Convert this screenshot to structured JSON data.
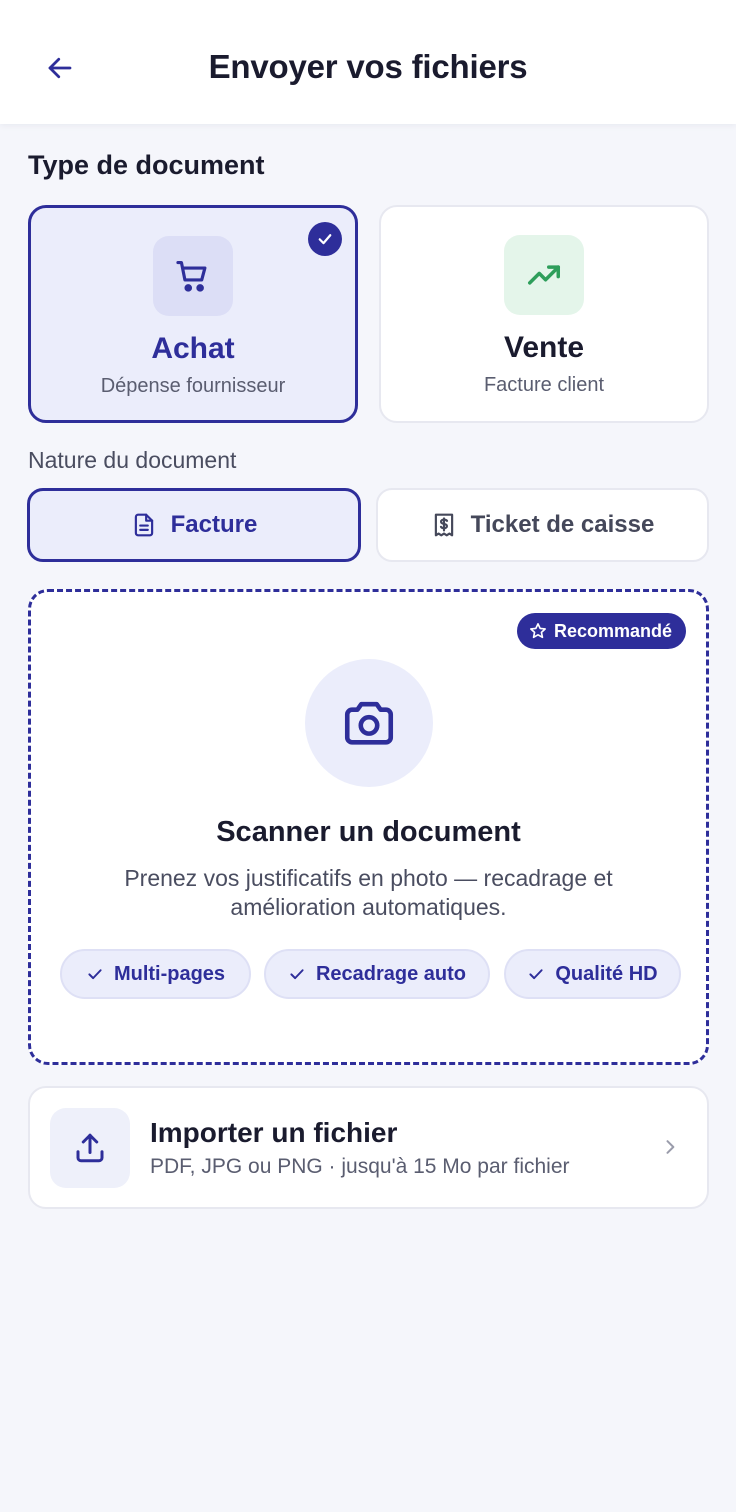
{
  "header": {
    "title": "Envoyer vos fichiers",
    "back_icon": "arrow-left-icon"
  },
  "document_type": {
    "section_title": "Type de document",
    "options": [
      {
        "label": "Achat",
        "subtitle": "Dépense fournisseur",
        "icon": "shopping-cart-icon",
        "selected": true
      },
      {
        "label": "Vente",
        "subtitle": "Facture client",
        "icon": "trending-up-icon",
        "selected": false
      }
    ]
  },
  "document_nature": {
    "section_title": "Nature du document",
    "options": [
      {
        "label": "Facture",
        "icon": "file-text-icon",
        "selected": true
      },
      {
        "label": "Ticket de caisse",
        "icon": "receipt-icon",
        "selected": false
      }
    ]
  },
  "scan": {
    "badge": "Recommandé",
    "badge_icon": "star-icon",
    "icon": "camera-icon",
    "title": "Scanner un document",
    "description": "Prenez vos justificatifs en photo — recadrage et amélioration automatiques.",
    "features": [
      "Multi-pages",
      "Recadrage auto",
      "Qualité HD"
    ]
  },
  "import": {
    "icon": "upload-icon",
    "title": "Importer un fichier",
    "subtitle": "PDF, JPG ou PNG · jusqu'à 15 Mo par fichier"
  },
  "colors": {
    "accent": "#2E2E9A",
    "accent_light": "#EBEDFB",
    "success": "#2E9E5B",
    "background": "#F5F6FB"
  }
}
